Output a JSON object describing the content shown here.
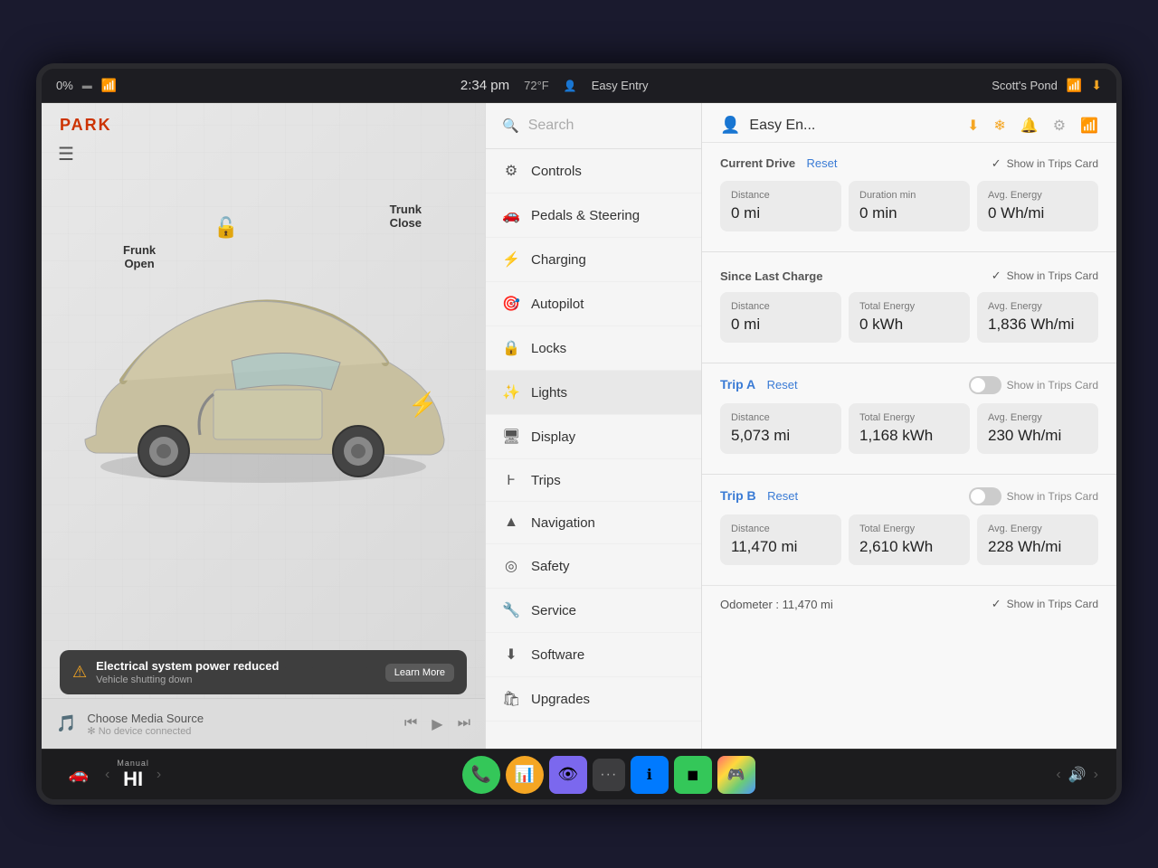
{
  "statusBar": {
    "battery": "0%",
    "time": "2:34 pm",
    "temperature": "72°F",
    "profile": "Easy Entry",
    "location": "Scott's Pond"
  },
  "leftPanel": {
    "parkLabel": "PARK",
    "frunkLabel": "Frunk\nOpen",
    "trunkLabel": "Trunk\nClose",
    "frunkText": "Frunk",
    "frunkStatus": "Open",
    "trunkText": "Trunk",
    "trunkStatus": "Close",
    "warning": {
      "title": "Electrical system power reduced",
      "subtitle": "Vehicle shutting down",
      "learnMore": "Learn More"
    },
    "media": {
      "title": "Choose Media Source",
      "subtitle": "✻ No device connected"
    }
  },
  "menu": {
    "searchPlaceholder": "Search",
    "items": [
      {
        "id": "search",
        "label": "Search",
        "icon": "🔍"
      },
      {
        "id": "controls",
        "label": "Controls",
        "icon": "⚙"
      },
      {
        "id": "pedals",
        "label": "Pedals & Steering",
        "icon": "🚗"
      },
      {
        "id": "charging",
        "label": "Charging",
        "icon": "⚡"
      },
      {
        "id": "autopilot",
        "label": "Autopilot",
        "icon": "🎯"
      },
      {
        "id": "locks",
        "label": "Locks",
        "icon": "🔒"
      },
      {
        "id": "lights",
        "label": "Lights",
        "icon": "✨"
      },
      {
        "id": "display",
        "label": "Display",
        "icon": "🖥"
      },
      {
        "id": "trips",
        "label": "Trips",
        "icon": "📍"
      },
      {
        "id": "navigation",
        "label": "Navigation",
        "icon": "▲"
      },
      {
        "id": "safety",
        "label": "Safety",
        "icon": "⊙"
      },
      {
        "id": "service",
        "label": "Service",
        "icon": "🔧"
      },
      {
        "id": "software",
        "label": "Software",
        "icon": "⬇"
      },
      {
        "id": "upgrades",
        "label": "Upgrades",
        "icon": "🛍"
      }
    ]
  },
  "rightPanel": {
    "title": "Easy En...",
    "currentDrive": {
      "sectionTitle": "Current Drive",
      "resetLabel": "Reset",
      "showInTrips": "Show in Trips Card",
      "distance": {
        "label": "Distance",
        "value": "0 mi"
      },
      "duration": {
        "label": "Duration min",
        "value": "0 min"
      },
      "avgEnergy": {
        "label": "Avg. Energy",
        "value": "0 Wh/mi"
      }
    },
    "sinceLastCharge": {
      "sectionTitle": "Since Last Charge",
      "showInTrips": "Show in Trips Card",
      "distance": {
        "label": "Distance",
        "value": "0 mi"
      },
      "totalEnergy": {
        "label": "Total Energy",
        "value": "0 kWh"
      },
      "avgEnergy": {
        "label": "Avg. Energy",
        "value": "1,836 Wh/mi"
      }
    },
    "tripA": {
      "label": "Trip A",
      "resetLabel": "Reset",
      "showInTrips": "Show in Trips Card",
      "distance": {
        "label": "Distance",
        "value": "5,073 mi"
      },
      "totalEnergy": {
        "label": "Total Energy",
        "value": "1,168 kWh"
      },
      "avgEnergy": {
        "label": "Avg. Energy",
        "value": "230 Wh/mi"
      }
    },
    "tripB": {
      "label": "Trip B",
      "resetLabel": "Reset",
      "showInTrips": "Show in Trips Card",
      "distance": {
        "label": "Distance",
        "value": "11,470 mi"
      },
      "totalEnergy": {
        "label": "Total Energy",
        "value": "2,610 kWh"
      },
      "avgEnergy": {
        "label": "Avg. Energy",
        "value": "228 Wh/mi"
      }
    },
    "odometer": {
      "label": "Odometer : 11,470 mi",
      "showInTrips": "Show in Trips Card"
    }
  },
  "taskbar": {
    "climate": {
      "manual": "Manual",
      "temp": "HI"
    },
    "buttons": [
      {
        "id": "phone",
        "color": "green",
        "icon": "📞"
      },
      {
        "id": "audio",
        "color": "orange",
        "icon": "📊"
      },
      {
        "id": "camera",
        "color": "purple",
        "icon": "👁"
      },
      {
        "id": "more",
        "icon": "···"
      },
      {
        "id": "info",
        "color": "blue",
        "icon": "ℹ"
      },
      {
        "id": "app1",
        "color": "green2",
        "icon": "◼"
      },
      {
        "id": "app2",
        "color": "colorful",
        "icon": "🎮"
      }
    ]
  }
}
